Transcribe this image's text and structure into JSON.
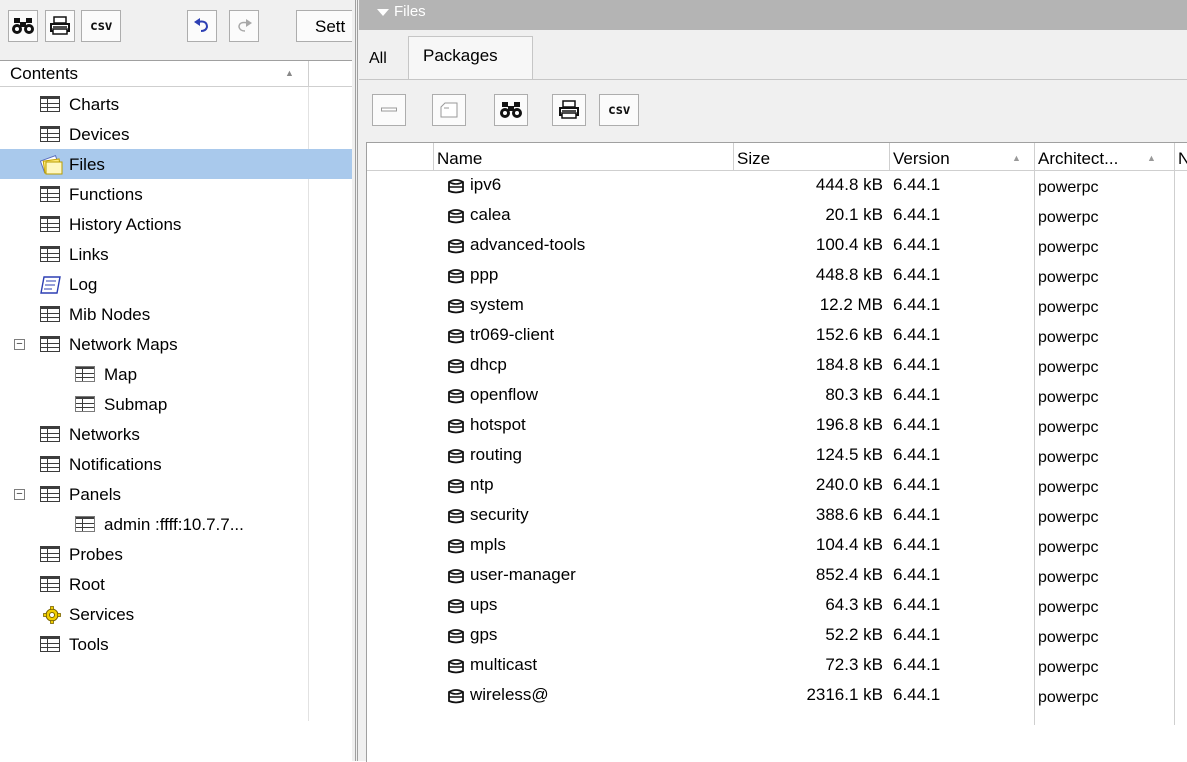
{
  "left_toolbar": {
    "find_icon": "binoculars-icon",
    "print_icon": "printer-icon",
    "csv_label": "csv",
    "undo_icon": "undo-icon",
    "redo_icon": "redo-icon",
    "settings_label": "Sett"
  },
  "tree": {
    "header": "Contents",
    "items": [
      {
        "label": "Charts",
        "icon": "table-icon"
      },
      {
        "label": "Devices",
        "icon": "table-icon"
      },
      {
        "label": "Files",
        "icon": "files-icon",
        "selected": true
      },
      {
        "label": "Functions",
        "icon": "table-icon"
      },
      {
        "label": "History Actions",
        "icon": "table-icon"
      },
      {
        "label": "Links",
        "icon": "table-icon"
      },
      {
        "label": "Log",
        "icon": "log-icon"
      },
      {
        "label": "Mib Nodes",
        "icon": "table-icon"
      },
      {
        "label": "Network Maps",
        "icon": "table-icon",
        "expanded": true
      },
      {
        "label": "Map",
        "icon": "table-icon",
        "child": true
      },
      {
        "label": "Submap",
        "icon": "table-icon",
        "child": true
      },
      {
        "label": "Networks",
        "icon": "table-icon"
      },
      {
        "label": "Notifications",
        "icon": "table-icon"
      },
      {
        "label": "Panels",
        "icon": "table-icon",
        "expanded": true
      },
      {
        "label": "admin :ffff:10.7.7...",
        "icon": "table-icon",
        "child": true
      },
      {
        "label": "Probes",
        "icon": "table-icon"
      },
      {
        "label": "Root",
        "icon": "table-icon"
      },
      {
        "label": "Services",
        "icon": "gear-icon"
      },
      {
        "label": "Tools",
        "icon": "table-icon"
      }
    ]
  },
  "window": {
    "title": "Files",
    "tabs": [
      "All",
      "Packages"
    ],
    "active_tab": "Packages",
    "toolbar": {
      "remove_icon": "minus-icon",
      "comment_icon": "comment-icon",
      "find_icon": "binoculars-icon",
      "print_icon": "printer-icon",
      "csv_label": "csv"
    },
    "columns": [
      "Name",
      "Size",
      "Version",
      "Architect...",
      "N"
    ],
    "packages": [
      {
        "name": "ipv6",
        "size": "444.8 kB",
        "version": "6.44.1",
        "arch": "powerpc"
      },
      {
        "name": "calea",
        "size": "20.1 kB",
        "version": "6.44.1",
        "arch": "powerpc"
      },
      {
        "name": "advanced-tools",
        "size": "100.4 kB",
        "version": "6.44.1",
        "arch": "powerpc"
      },
      {
        "name": "ppp",
        "size": "448.8 kB",
        "version": "6.44.1",
        "arch": "powerpc"
      },
      {
        "name": "system",
        "size": "12.2 MB",
        "version": "6.44.1",
        "arch": "powerpc"
      },
      {
        "name": "tr069-client",
        "size": "152.6 kB",
        "version": "6.44.1",
        "arch": "powerpc"
      },
      {
        "name": "dhcp",
        "size": "184.8 kB",
        "version": "6.44.1",
        "arch": "powerpc"
      },
      {
        "name": "openflow",
        "size": "80.3 kB",
        "version": "6.44.1",
        "arch": "powerpc"
      },
      {
        "name": "hotspot",
        "size": "196.8 kB",
        "version": "6.44.1",
        "arch": "powerpc"
      },
      {
        "name": "routing",
        "size": "124.5 kB",
        "version": "6.44.1",
        "arch": "powerpc"
      },
      {
        "name": "ntp",
        "size": "240.0 kB",
        "version": "6.44.1",
        "arch": "powerpc"
      },
      {
        "name": "security",
        "size": "388.6 kB",
        "version": "6.44.1",
        "arch": "powerpc"
      },
      {
        "name": "mpls",
        "size": "104.4 kB",
        "version": "6.44.1",
        "arch": "powerpc"
      },
      {
        "name": "user-manager",
        "size": "852.4 kB",
        "version": "6.44.1",
        "arch": "powerpc"
      },
      {
        "name": "ups",
        "size": "64.3 kB",
        "version": "6.44.1",
        "arch": "powerpc"
      },
      {
        "name": "gps",
        "size": "52.2 kB",
        "version": "6.44.1",
        "arch": "powerpc"
      },
      {
        "name": "multicast",
        "size": "72.3 kB",
        "version": "6.44.1",
        "arch": "powerpc"
      },
      {
        "name": "wireless@",
        "size": "2316.1 kB",
        "version": "6.44.1",
        "arch": "powerpc"
      }
    ]
  },
  "colors": {
    "selection": "#a9c9ec",
    "titlebar": "#b4b4b4",
    "panel_bg": "#f0f0f0"
  }
}
